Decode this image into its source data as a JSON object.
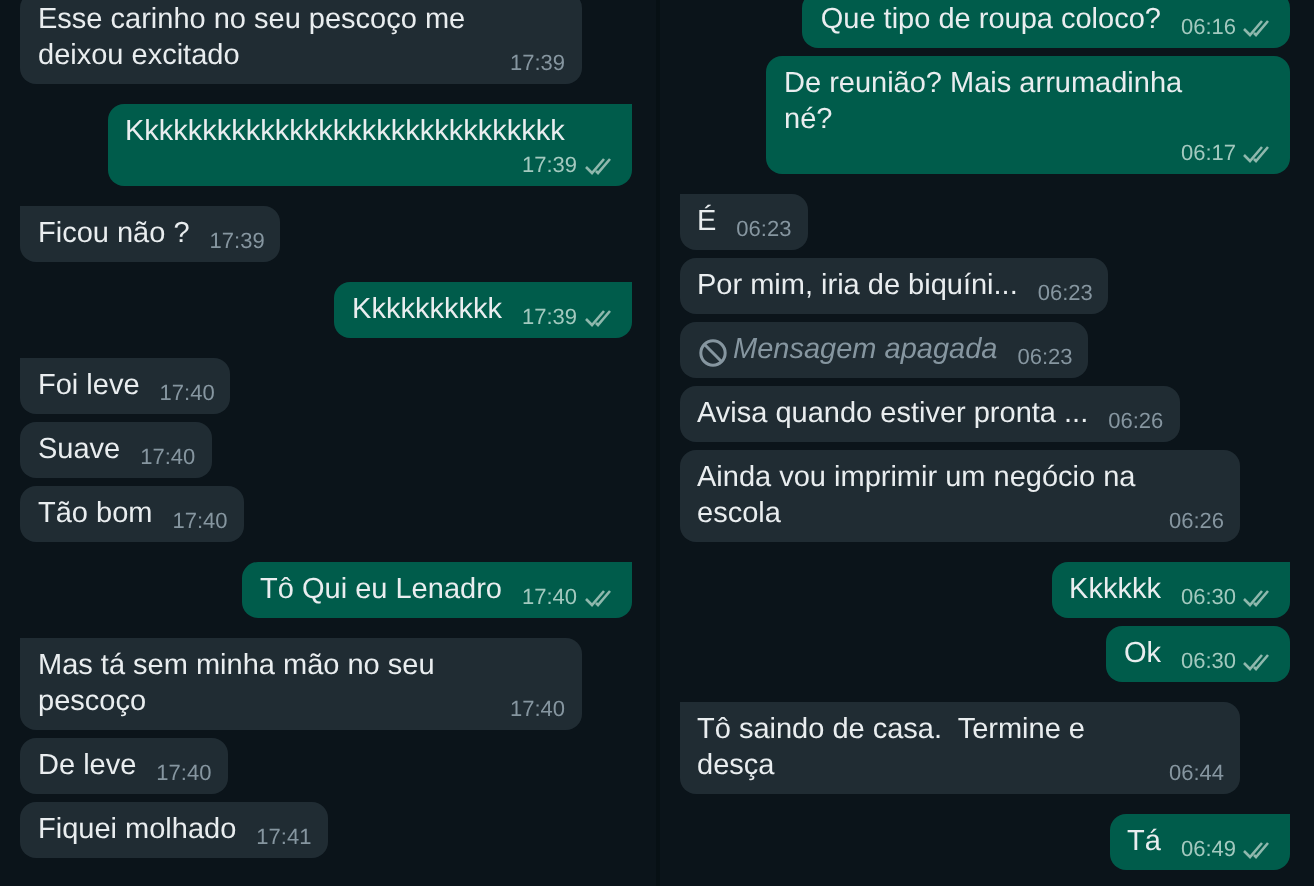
{
  "panels": [
    {
      "messages": [
        {
          "outgoing": false,
          "kind": "text",
          "text": "Esse carinho no seu pescoço me deixou excitado",
          "time": "17:39",
          "tail": false
        },
        {
          "outgoing": true,
          "kind": "text",
          "text": "Kkkkkkkkkkkkkkkkkkkkkkkkkkkkkk",
          "time": "17:39",
          "tail": true,
          "read": false
        },
        {
          "outgoing": false,
          "kind": "text",
          "text": "Ficou não ?",
          "time": "17:39",
          "tail": true
        },
        {
          "outgoing": true,
          "kind": "text",
          "text": "Kkkkkkkkkk",
          "time": "17:39",
          "tail": true,
          "read": false
        },
        {
          "outgoing": false,
          "kind": "text",
          "text": "Foi leve",
          "time": "17:40",
          "tail": true
        },
        {
          "outgoing": false,
          "kind": "text",
          "text": "Suave",
          "time": "17:40",
          "tail": false
        },
        {
          "outgoing": false,
          "kind": "text",
          "text": "Tão bom",
          "time": "17:40",
          "tail": false
        },
        {
          "outgoing": true,
          "kind": "text",
          "text": "Tô Qui eu Lenadro",
          "time": "17:40",
          "tail": true,
          "read": false
        },
        {
          "outgoing": false,
          "kind": "text",
          "text": "Mas tá sem minha mão no seu pescoço",
          "time": "17:40",
          "tail": true
        },
        {
          "outgoing": false,
          "kind": "text",
          "text": "De leve",
          "time": "17:40",
          "tail": false
        },
        {
          "outgoing": false,
          "kind": "text",
          "text": "Fiquei molhado",
          "time": "17:41",
          "tail": false
        }
      ]
    },
    {
      "messages": [
        {
          "outgoing": true,
          "kind": "text",
          "text": "Que tipo de roupa coloco?",
          "time": "06:16",
          "tail": false,
          "read": false
        },
        {
          "outgoing": true,
          "kind": "text",
          "text": "De reunião? Mais arrumadinha né?",
          "time": "06:17",
          "tail": false,
          "read": false
        },
        {
          "outgoing": false,
          "kind": "text",
          "text": "É",
          "time": "06:23",
          "tail": true
        },
        {
          "outgoing": false,
          "kind": "text",
          "text": "Por mim, iria de biquíni...",
          "time": "06:23",
          "tail": false
        },
        {
          "outgoing": false,
          "kind": "deleted",
          "text": "Mensagem apagada",
          "time": "06:23",
          "tail": false
        },
        {
          "outgoing": false,
          "kind": "text",
          "text": "Avisa quando estiver pronta ...",
          "time": "06:26",
          "tail": false
        },
        {
          "outgoing": false,
          "kind": "text",
          "text": "Ainda vou imprimir um negócio na escola",
          "time": "06:26",
          "tail": false
        },
        {
          "outgoing": true,
          "kind": "text",
          "text": "Kkkkkk",
          "time": "06:30",
          "tail": true,
          "read": false
        },
        {
          "outgoing": true,
          "kind": "text",
          "text": "Ok",
          "time": "06:30",
          "tail": false,
          "read": false
        },
        {
          "outgoing": false,
          "kind": "text",
          "text": "Tô saindo de casa.  Termine e desça",
          "time": "06:44",
          "tail": true
        },
        {
          "outgoing": true,
          "kind": "text",
          "text": "Tá",
          "time": "06:49",
          "tail": true,
          "read": false
        }
      ]
    }
  ]
}
